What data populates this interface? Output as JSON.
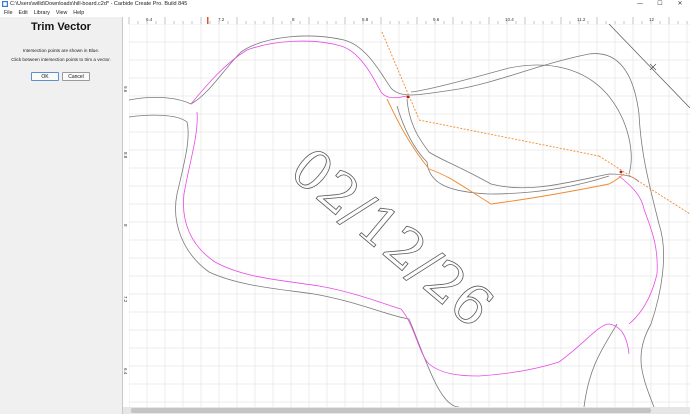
{
  "window": {
    "title": "C:\\Users\\willd\\Downloads\\hill-board.c2d* - Carbide Create Pro. Build 845",
    "minimize_glyph": "—",
    "maximize_glyph": "☐",
    "close_glyph": "✕"
  },
  "menu": {
    "items": [
      {
        "name": "menu-file",
        "label": "File"
      },
      {
        "name": "menu-edit",
        "label": "Edit"
      },
      {
        "name": "menu-library",
        "label": "Library"
      },
      {
        "name": "menu-view",
        "label": "View"
      },
      {
        "name": "menu-help",
        "label": "Help"
      }
    ]
  },
  "panel": {
    "heading": "Trim Vector",
    "instruction_1": "Intersection points are shown in Blue.",
    "instruction_2": "Click between intersection points to trim a vector.",
    "ok_label": "OK",
    "cancel_label": "Cancel"
  },
  "rulers": {
    "top_labels": [
      "6.4",
      "7.2",
      "8",
      "8.8",
      "9.6",
      "10.4",
      "11.2",
      "12"
    ],
    "left_labels": [
      "9.6",
      "8.8",
      "8",
      "7.2",
      "6.4"
    ]
  },
  "canvas": {
    "engraved_text": "02/12/26",
    "colors": {
      "vector": "#7a7a7a",
      "selected_offset": "#e64ce6",
      "trim_path": "#f08a30",
      "grid": "#dcdcdc",
      "intersection": "#c01818",
      "ruler_marker": "#e05030"
    }
  }
}
